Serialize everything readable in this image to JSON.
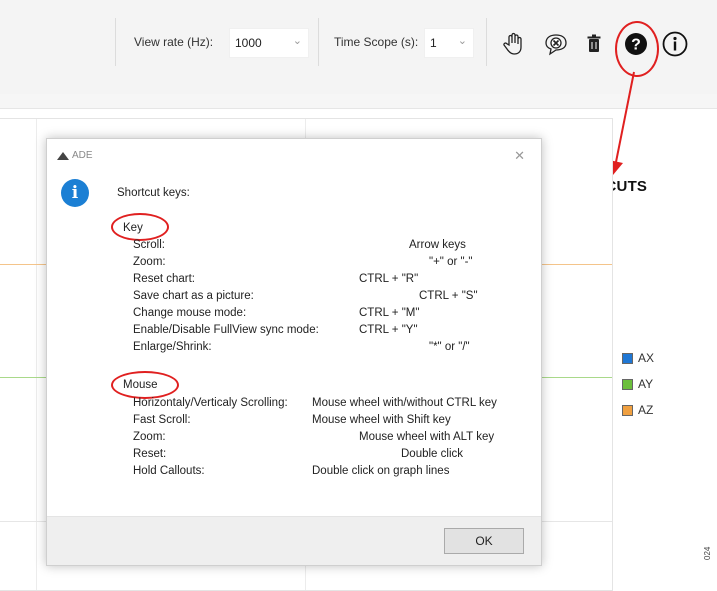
{
  "toolbar": {
    "view_rate_label": "View rate (Hz):",
    "view_rate_value": "1000",
    "time_scope_label": "Time Scope (s):",
    "time_scope_value": "1",
    "buttons": [
      "hand-icon",
      "clear-callouts-icon",
      "delete-icon",
      "help-icon",
      "info-icon"
    ]
  },
  "annotation": {
    "label": "SHORTCUTS",
    "color": "#e02020"
  },
  "legend": [
    {
      "label": "AX",
      "color": "#1f77d4"
    },
    {
      "label": "AY",
      "color": "#6cbf3c"
    },
    {
      "label": "AZ",
      "color": "#f0a040"
    }
  ],
  "figure_code": "024",
  "dialog": {
    "title": "ADE",
    "heading": "Shortcut keys:",
    "key_section": "Key",
    "key_shortcuts": [
      {
        "action": "Scroll:",
        "keys": "Arrow keys"
      },
      {
        "action": "Zoom:",
        "keys": "\"+\" or \"-\""
      },
      {
        "action": "Reset chart:",
        "keys": "CTRL + \"R\""
      },
      {
        "action": "Save chart as a picture:",
        "keys": "CTRL + \"S\""
      },
      {
        "action": "Change mouse mode:",
        "keys": "CTRL + \"M\""
      },
      {
        "action": "Enable/Disable FullView sync mode:",
        "keys": "CTRL + \"Y\""
      },
      {
        "action": "Enlarge/Shrink:",
        "keys": "\"*\" or \"/\""
      }
    ],
    "mouse_section": "Mouse",
    "mouse_shortcuts": [
      {
        "action": "Horizontaly/Verticaly Scrolling:",
        "keys": "Mouse wheel with/without CTRL key"
      },
      {
        "action": "Fast Scroll:",
        "keys": "Mouse wheel with Shift key"
      },
      {
        "action": "Zoom:",
        "keys": "Mouse wheel with ALT key"
      },
      {
        "action": "Reset:",
        "keys": "Double click"
      },
      {
        "action": "Hold Callouts:",
        "keys": "Double click on graph lines"
      }
    ],
    "ok_label": "OK"
  }
}
